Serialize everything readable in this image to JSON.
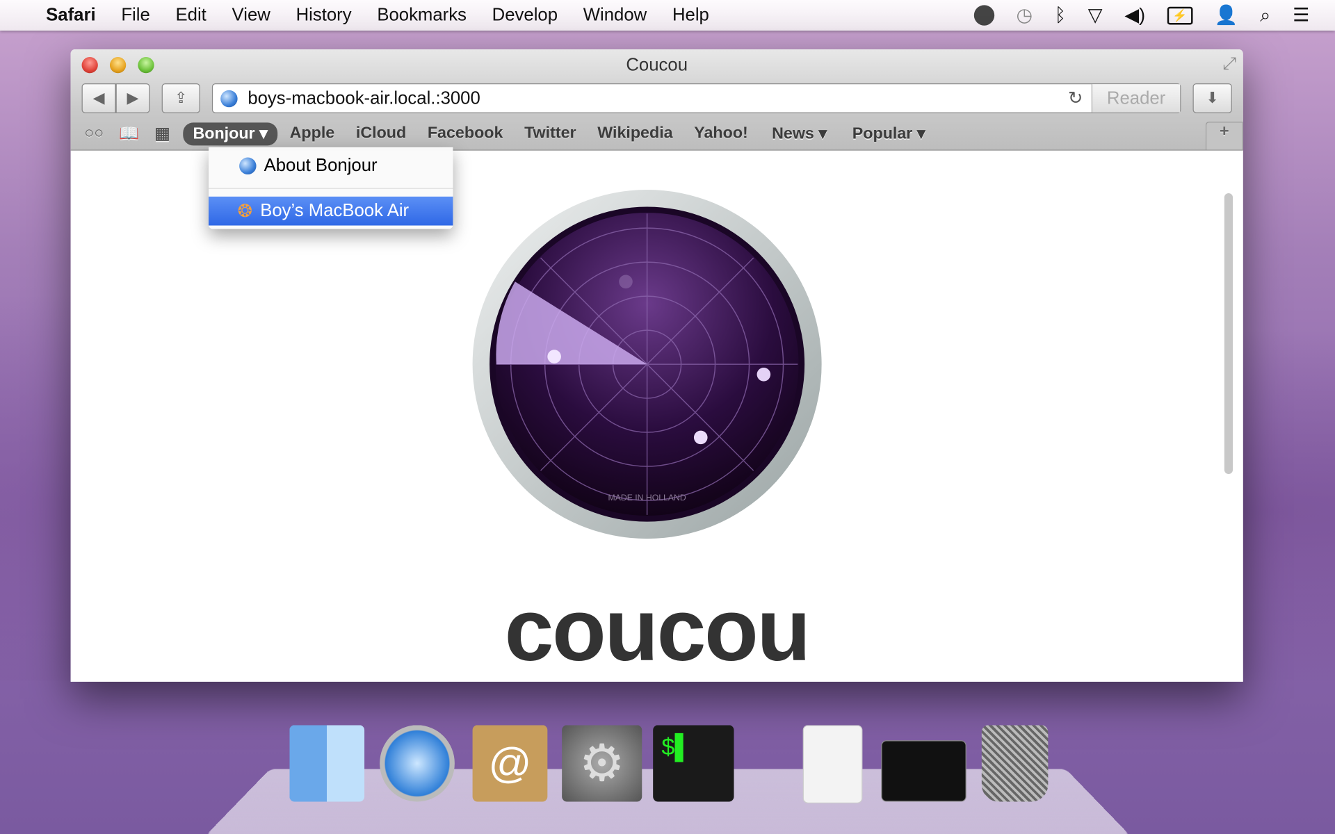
{
  "menubar": {
    "app": "Safari",
    "items": [
      "File",
      "Edit",
      "View",
      "History",
      "Bookmarks",
      "Develop",
      "Window",
      "Help"
    ],
    "status_icons": [
      "clock-icon",
      "time-machine-icon",
      "bluetooth-icon",
      "wifi-icon",
      "volume-icon",
      "battery-charging-icon",
      "user-icon",
      "spotlight-search-icon",
      "notification-center-icon"
    ]
  },
  "window": {
    "title": "Coucou",
    "url": "boys-macbook-air.local.:3000",
    "reader_label": "Reader"
  },
  "bookmarks": {
    "items": [
      "Bonjour",
      "Apple",
      "iCloud",
      "Facebook",
      "Twitter",
      "Wikipedia",
      "Yahoo!",
      "News",
      "Popular"
    ],
    "dropdowns": [
      "Bonjour",
      "News",
      "Popular"
    ]
  },
  "bonjour_menu": {
    "items": [
      "About Bonjour",
      "Boy’s MacBook Air"
    ],
    "selected": "Boy’s MacBook Air"
  },
  "page": {
    "heading": "coucou",
    "logo_text": "MADE IN HOLLAND"
  },
  "dock": {
    "apps": [
      "Finder",
      "Safari",
      "Contacts",
      "System Preferences",
      "Terminal",
      "Documents",
      "Terminal window",
      "Trash"
    ]
  },
  "colors": {
    "highlight": "#3d78f0",
    "radar": "#2a0f3c"
  }
}
